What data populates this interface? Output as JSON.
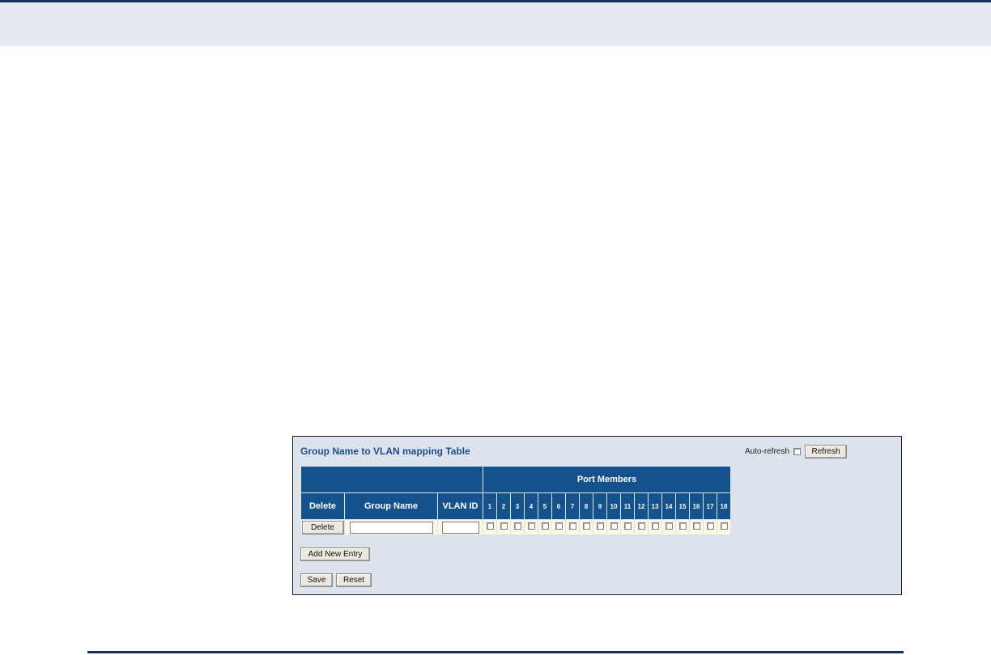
{
  "panel": {
    "title": "Group Name to VLAN mapping Table",
    "auto_refresh_label": "Auto-refresh",
    "refresh_label": "Refresh"
  },
  "table": {
    "port_members_label": "Port Members",
    "headers": {
      "delete": "Delete",
      "group_name": "Group Name",
      "vlan_id": "VLAN ID"
    },
    "ports": [
      "1",
      "2",
      "3",
      "4",
      "5",
      "6",
      "7",
      "8",
      "9",
      "10",
      "11",
      "12",
      "13",
      "14",
      "15",
      "16",
      "17",
      "18"
    ],
    "row": {
      "delete_label": "Delete",
      "group_name_value": "",
      "vlan_id_value": ""
    }
  },
  "buttons": {
    "add_new_entry": "Add New Entry",
    "save": "Save",
    "reset": "Reset"
  },
  "colors": {
    "header_bg": "#15518a",
    "panel_bg": "#dde3ec",
    "title_color": "#1f4e8c",
    "row_bg": "#fbf9e6",
    "rule": "#14305a"
  }
}
